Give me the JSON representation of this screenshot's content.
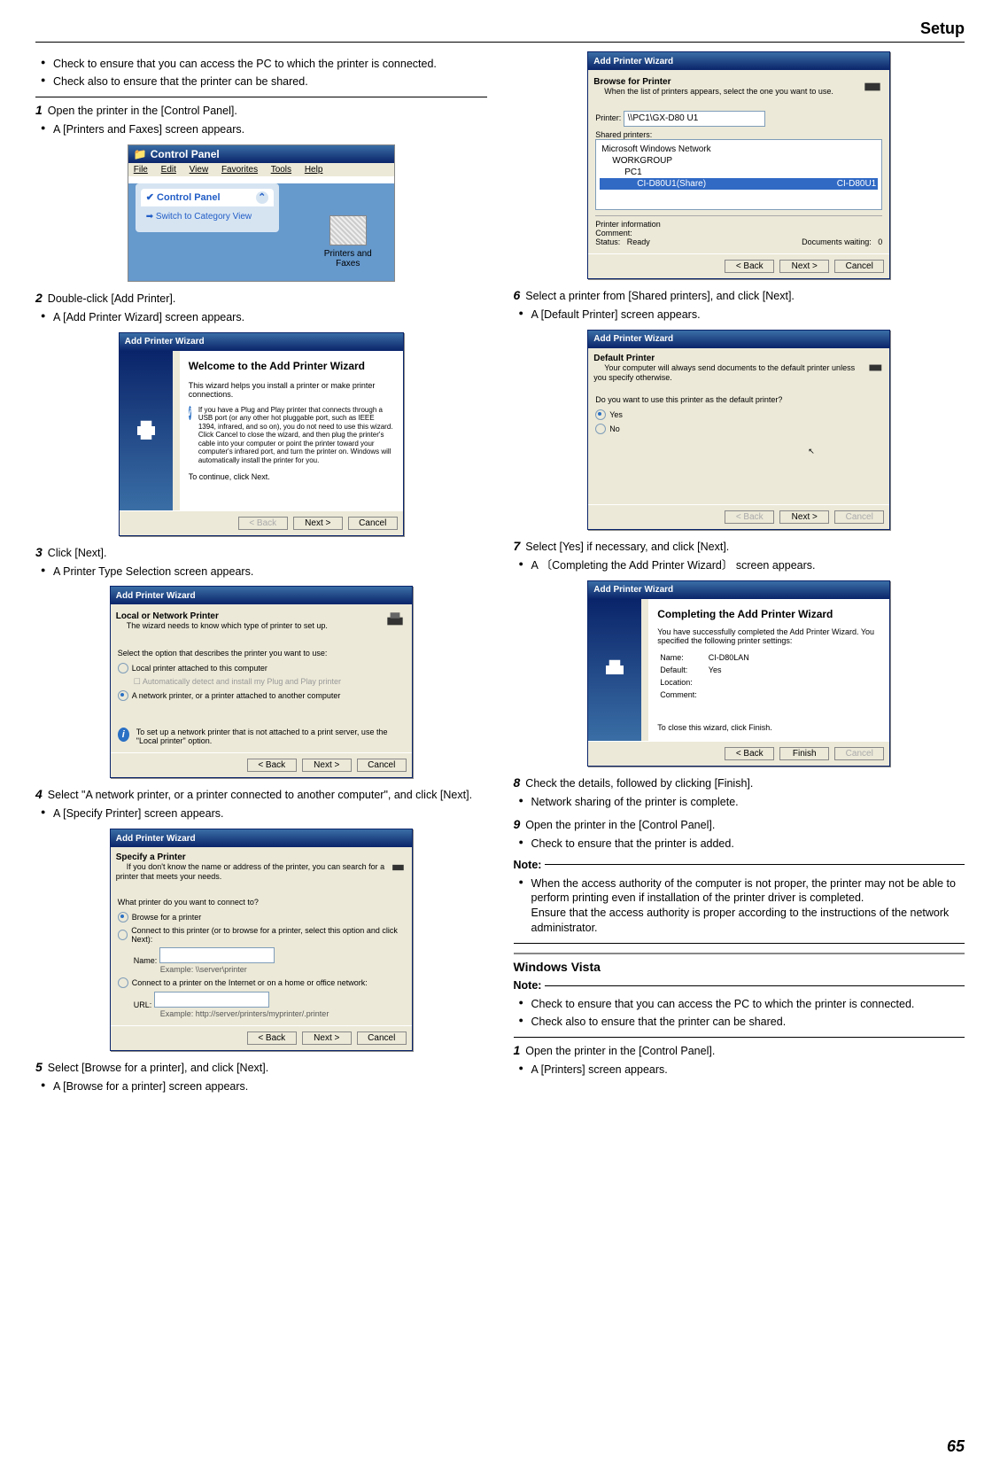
{
  "page": {
    "header": "Setup",
    "number": "65"
  },
  "col1": {
    "intro_bullets": [
      "Check to ensure that you can access the PC to which the printer is connected.",
      "Check also to ensure that the printer can be shared."
    ],
    "s1": {
      "num": "1",
      "text": "Open the printer in the [Control Panel].",
      "b": "A [Printers and Faxes] screen appears."
    },
    "cp": {
      "title": "Control Panel",
      "menus": [
        "File",
        "Edit",
        "View",
        "Favorites",
        "Tools",
        "Help"
      ],
      "panel_title": "Control Panel",
      "switch": "Switch to Category View",
      "icon_label": "Printers and Faxes"
    },
    "s2": {
      "num": "2",
      "text": "Double-click [Add Printer].",
      "b": "A [Add Printer Wizard] screen appears."
    },
    "w1": {
      "title": "Add Printer Wizard",
      "h": "Welcome to the Add Printer Wizard",
      "p1": "This wizard helps you install a printer or make printer connections.",
      "note": "If you have a Plug and Play printer that connects through a USB port (or any other hot pluggable port, such as IEEE 1394, infrared, and so on), you do not need to use this wizard. Click Cancel to close the wizard, and then plug the printer's cable into your computer or point the printer toward your computer's infrared port, and turn the printer on. Windows will automatically install the printer for you.",
      "p2": "To continue, click Next.",
      "back": "< Back",
      "next": "Next >",
      "cancel": "Cancel"
    },
    "s3": {
      "num": "3",
      "text": "Click [Next].",
      "b": "A Printer Type Selection screen appears."
    },
    "w2": {
      "title": "Add Printer Wizard",
      "h": "Local or Network Printer",
      "sub": "The wizard needs to know which type of printer to set up.",
      "q": "Select the option that describes the printer you want to use:",
      "r1": "Local printer attached to this computer",
      "r1sub": "Automatically detect and install my Plug and Play printer",
      "r2": "A network printer, or a printer attached to another computer",
      "tip": "To set up a network printer that is not attached to a print server, use the \"Local printer\" option.",
      "back": "< Back",
      "next": "Next >",
      "cancel": "Cancel"
    },
    "s4": {
      "num": "4",
      "text": "Select \"A network printer, or a printer connected to another computer\", and click [Next].",
      "b": "A [Specify Printer] screen appears."
    },
    "w3": {
      "title": "Add Printer Wizard",
      "h": "Specify a Printer",
      "sub": "If you don't know the name or address of the printer, you can search for a printer that meets your needs.",
      "q": "What printer do you want to connect to?",
      "r1": "Browse for a printer",
      "r2": "Connect to this printer (or to browse for a printer, select this option and click Next):",
      "name_lbl": "Name:",
      "name_ex": "Example: \\\\server\\printer",
      "r3": "Connect to a printer on the Internet or on a home or office network:",
      "url_lbl": "URL:",
      "url_ex": "Example: http://server/printers/myprinter/.printer",
      "back": "< Back",
      "next": "Next >",
      "cancel": "Cancel"
    },
    "s5": {
      "num": "5",
      "text": "Select [Browse for a printer], and click [Next].",
      "b": "A [Browse for a printer] screen appears."
    }
  },
  "col2": {
    "w4": {
      "title": "Add Printer Wizard",
      "h": "Browse for Printer",
      "sub": "When the list of printers appears, select the one you want to use.",
      "printer_lbl": "Printer:",
      "printer_val": "\\\\PC1\\GX-D80 U1",
      "shared_lbl": "Shared printers:",
      "tree": [
        "Microsoft Windows Network",
        "  WORKGROUP",
        "    PC1"
      ],
      "tree_sel_left": "CI-D80U1(Share)",
      "tree_sel_right": "CI-D80U1",
      "info_h": "Printer information",
      "comment": "Comment:",
      "status_lbl": "Status:",
      "status_val": "Ready",
      "docs_lbl": "Documents waiting:",
      "docs_val": "0",
      "back": "< Back",
      "next": "Next >",
      "cancel": "Cancel"
    },
    "s6": {
      "num": "6",
      "text": "Select a printer from [Shared printers], and click [Next].",
      "b": "A [Default Printer] screen appears."
    },
    "w5": {
      "title": "Add Printer Wizard",
      "h": "Default Printer",
      "sub": "Your computer will always send documents to the default printer unless you specify otherwise.",
      "q": "Do you want to use this printer as the default printer?",
      "yes": "Yes",
      "no": "No",
      "back": "< Back",
      "next": "Next >",
      "cancel": "Cancel"
    },
    "s7": {
      "num": "7",
      "text": "Select [Yes] if necessary, and click [Next].",
      "b": "A 〔Completing the Add Printer Wizard〕 screen appears."
    },
    "w6": {
      "title": "Add Printer Wizard",
      "h": "Completing the Add Printer Wizard",
      "p1": "You have successfully completed the Add Printer Wizard. You specified the following printer settings:",
      "lbl_name": "Name:",
      "val_name": "CI-D80LAN",
      "lbl_def": "Default:",
      "val_def": "Yes",
      "lbl_loc": "Location:",
      "lbl_com": "Comment:",
      "p2": "To close this wizard, click Finish.",
      "back": "< Back",
      "finish": "Finish",
      "cancel": "Cancel"
    },
    "s8": {
      "num": "8",
      "text": "Check the details, followed by clicking [Finish].",
      "b": "Network sharing of the printer is complete."
    },
    "s9": {
      "num": "9",
      "text": "Open the printer in the [Control Panel].",
      "b": "Check to ensure that the printer is added."
    },
    "note_label": "Note:",
    "note_items": [
      "When the access authority of the computer is not proper, the printer may not be able to perform printing even if installation of the printer driver is completed.\nEnsure that the access authority is proper according to the instructions of the network administrator."
    ],
    "vista_head": "Windows Vista",
    "vista_note_label": "Note:",
    "vista_bullets": [
      "Check to ensure that you can access the PC to which the printer is connected.",
      "Check also to ensure that the printer can be shared."
    ],
    "vs1": {
      "num": "1",
      "text": "Open the printer in the [Control Panel].",
      "b": "A [Printers] screen appears."
    }
  }
}
